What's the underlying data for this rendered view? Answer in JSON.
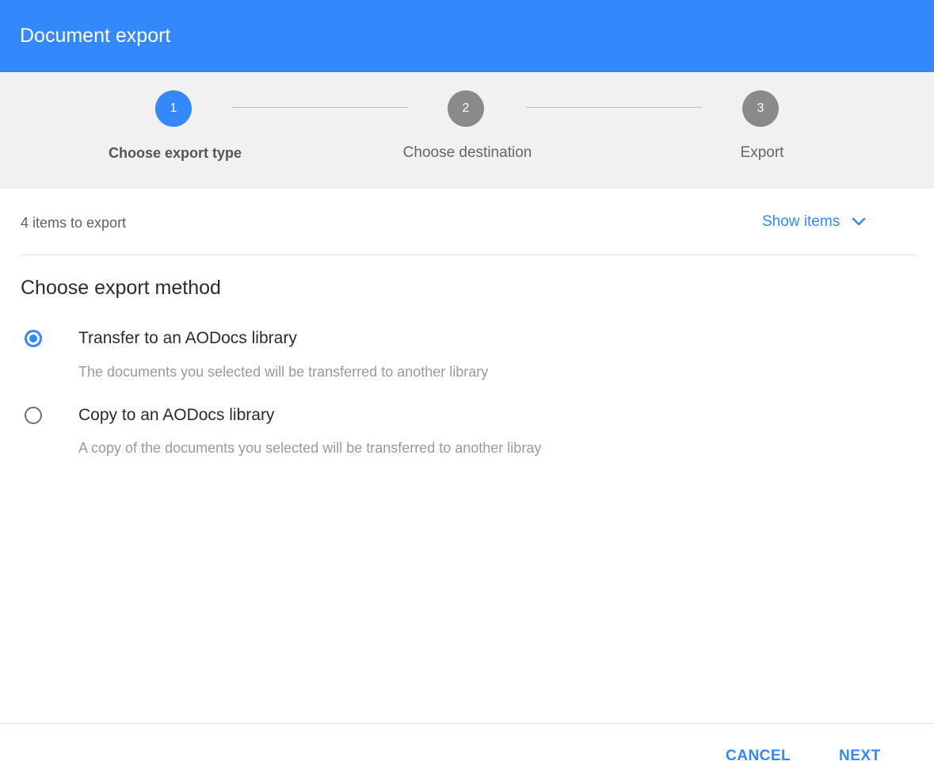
{
  "header": {
    "title": "Document export"
  },
  "stepper": {
    "steps": [
      {
        "number": "1",
        "label": "Choose export type",
        "state": "active"
      },
      {
        "number": "2",
        "label": "Choose destination",
        "state": "inactive"
      },
      {
        "number": "3",
        "label": "Export",
        "state": "inactive"
      }
    ]
  },
  "items": {
    "count_text": "4 items to export",
    "show_items_label": "Show items"
  },
  "export_method": {
    "title": "Choose export method",
    "options": [
      {
        "title": "Transfer to an AODocs library",
        "description": "The documents you selected will be transferred to another library",
        "selected": true
      },
      {
        "title": "Copy to an AODocs library",
        "description": "A copy of the documents you selected will be transferred to another libray",
        "selected": false
      }
    ]
  },
  "footer": {
    "cancel_label": "CANCEL",
    "next_label": "NEXT"
  },
  "colors": {
    "accent": "#3388fb",
    "inactive_step": "#8a8a8a",
    "stepper_bg": "#f1f1f1"
  }
}
